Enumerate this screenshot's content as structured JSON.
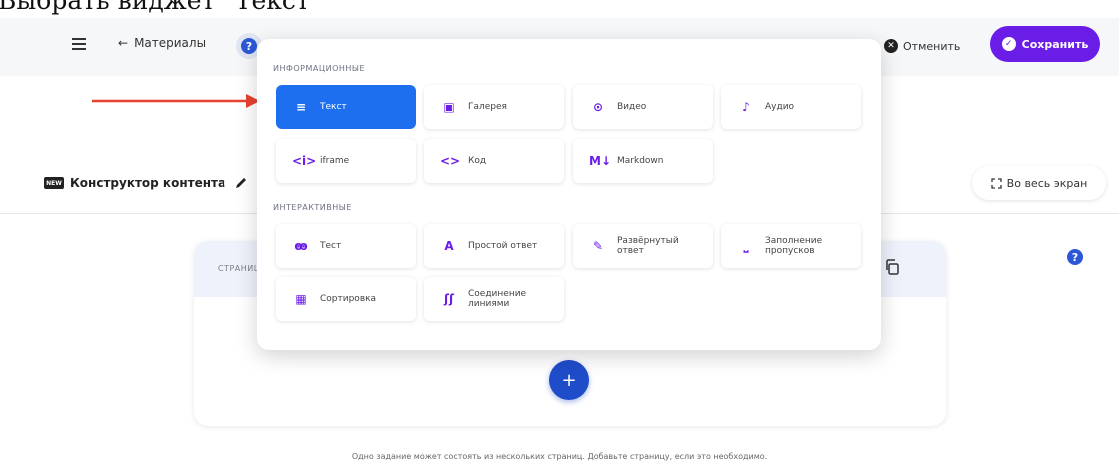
{
  "caption": "Выбрать виджет \"Текст\"",
  "header": {
    "back_label": "Материалы",
    "help_label": "?",
    "cancel_label": "Отменить",
    "save_label": "Сохранить"
  },
  "subheader": {
    "badge": "NEW",
    "builder_label": "Конструктор контента",
    "fullscreen_label": "Во весь экран"
  },
  "page": {
    "label": "СТРАНИЦА",
    "help_label": "?",
    "add_label": "+",
    "hint": "Одно задание может состоять из нескольких страниц. Добавьте страницу, если это необходимо."
  },
  "popup": {
    "sections": [
      {
        "title": "ИНФОРМАЦИОННЫЕ",
        "items": [
          {
            "label": "Текст",
            "icon": "text-lines-icon",
            "glyph": "≡",
            "active": true
          },
          {
            "label": "Галерея",
            "icon": "gallery-icon",
            "glyph": "▣"
          },
          {
            "label": "Видео",
            "icon": "play-circle-icon",
            "glyph": "⊙"
          },
          {
            "label": "Аудио",
            "icon": "music-note-icon",
            "glyph": "♪"
          },
          {
            "label": "iframe",
            "icon": "iframe-icon",
            "glyph": "<i>"
          },
          {
            "label": "Код",
            "icon": "code-icon",
            "glyph": "<>"
          },
          {
            "label": "Markdown",
            "icon": "markdown-icon",
            "glyph": "M↓"
          }
        ]
      },
      {
        "title": "ИНТЕРАКТИВНЫЕ",
        "items": [
          {
            "label": "Тест",
            "icon": "test-icon",
            "glyph": "ꙭ"
          },
          {
            "label": "Простой ответ",
            "icon": "simple-answer-icon",
            "glyph": "A"
          },
          {
            "label": "Развёрнутый ответ",
            "icon": "pen-icon",
            "glyph": "✎"
          },
          {
            "label": "Заполнение пропусков",
            "icon": "gap-fill-icon",
            "glyph": "⎵"
          },
          {
            "label": "Сортировка",
            "icon": "grid-sort-icon",
            "glyph": "▦"
          },
          {
            "label": "Соединение линиями",
            "icon": "connect-lines-icon",
            "glyph": "ʃʃ"
          }
        ]
      }
    ]
  },
  "colors": {
    "accent": "#6b1de8",
    "active": "#1e6ff0",
    "primary_blue": "#1f4cc9",
    "arrow": "#e8412f"
  }
}
